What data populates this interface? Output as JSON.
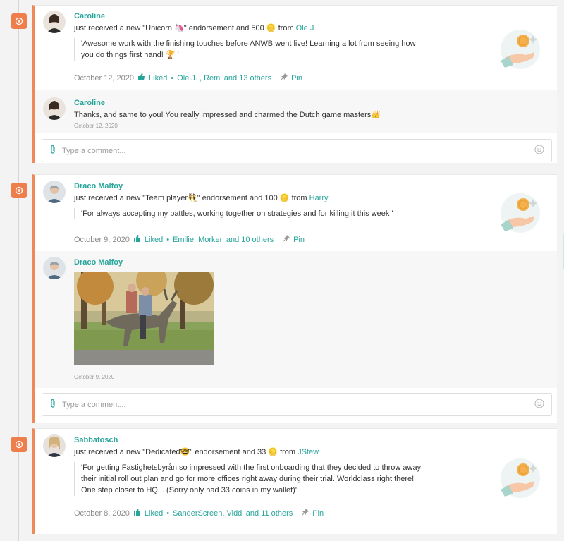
{
  "comment_placeholder": "Type a comment...",
  "posts": [
    {
      "author": "Caroline",
      "action_prefix": "just received a new \"Unicorn ",
      "badge_emoji": "🦄",
      "action_mid": "\" endorsement and 500 ",
      "coin_emoji": "🪙",
      "from_word": "from",
      "from_name": "Ole J.",
      "quote": "'Awesome work with the finishing touches before ANWB went live! Learning a lot from seeing how you do things first hand! 🏆 '",
      "date": "October 12, 2020",
      "liked_label": "Liked",
      "likers": "Ole J. , Remi and 13 others",
      "pin_label": "Pin",
      "reply": {
        "author": "Caroline",
        "text": "Thanks, and same to you! You really impressed and charmed the Dutch game masters👑",
        "date": "October 12, 2020"
      }
    },
    {
      "author": "Draco Malfoy",
      "action_prefix": "just received a new \"Team player",
      "badge_emoji": "👯",
      "action_mid": "\" endorsement and 100 ",
      "coin_emoji": "🪙",
      "from_word": "from",
      "from_name": "Harry",
      "quote": "'For always accepting my battles, working together on strategies and for killing it this week '",
      "date": "October 9, 2020",
      "liked_label": "Liked",
      "likers": "Emilie, Morken and 10 others",
      "pin_label": "Pin",
      "reply": {
        "author": "Draco Malfoy",
        "date": "October 9, 2020",
        "image_name": "gif-two-men-riding-deer-statue"
      }
    },
    {
      "author": "Sabbatosch",
      "action_prefix": "just received a new \"Dedicated",
      "badge_emoji": "🤓",
      "action_mid": "\" endorsement and 33 ",
      "coin_emoji": "🪙",
      "from_word": "from",
      "from_name": "JStew",
      "quote": "'For getting Fastighetsbyrån so impressed with the first onboarding that they decided to throw away their initial roll out plan and go for more offices right away during their trial. Worldclass right there! One step closer to HQ... (Sorry only had 33 coins in my wallet)'",
      "date": "October 8, 2020",
      "liked_label": "Liked",
      "likers": "SanderScreen, Viddi and 11 others",
      "pin_label": "Pin"
    }
  ],
  "colors": {
    "accent": "#27a59b",
    "timeline": "#ee7f4c",
    "card_border": "#ee8a5a"
  }
}
